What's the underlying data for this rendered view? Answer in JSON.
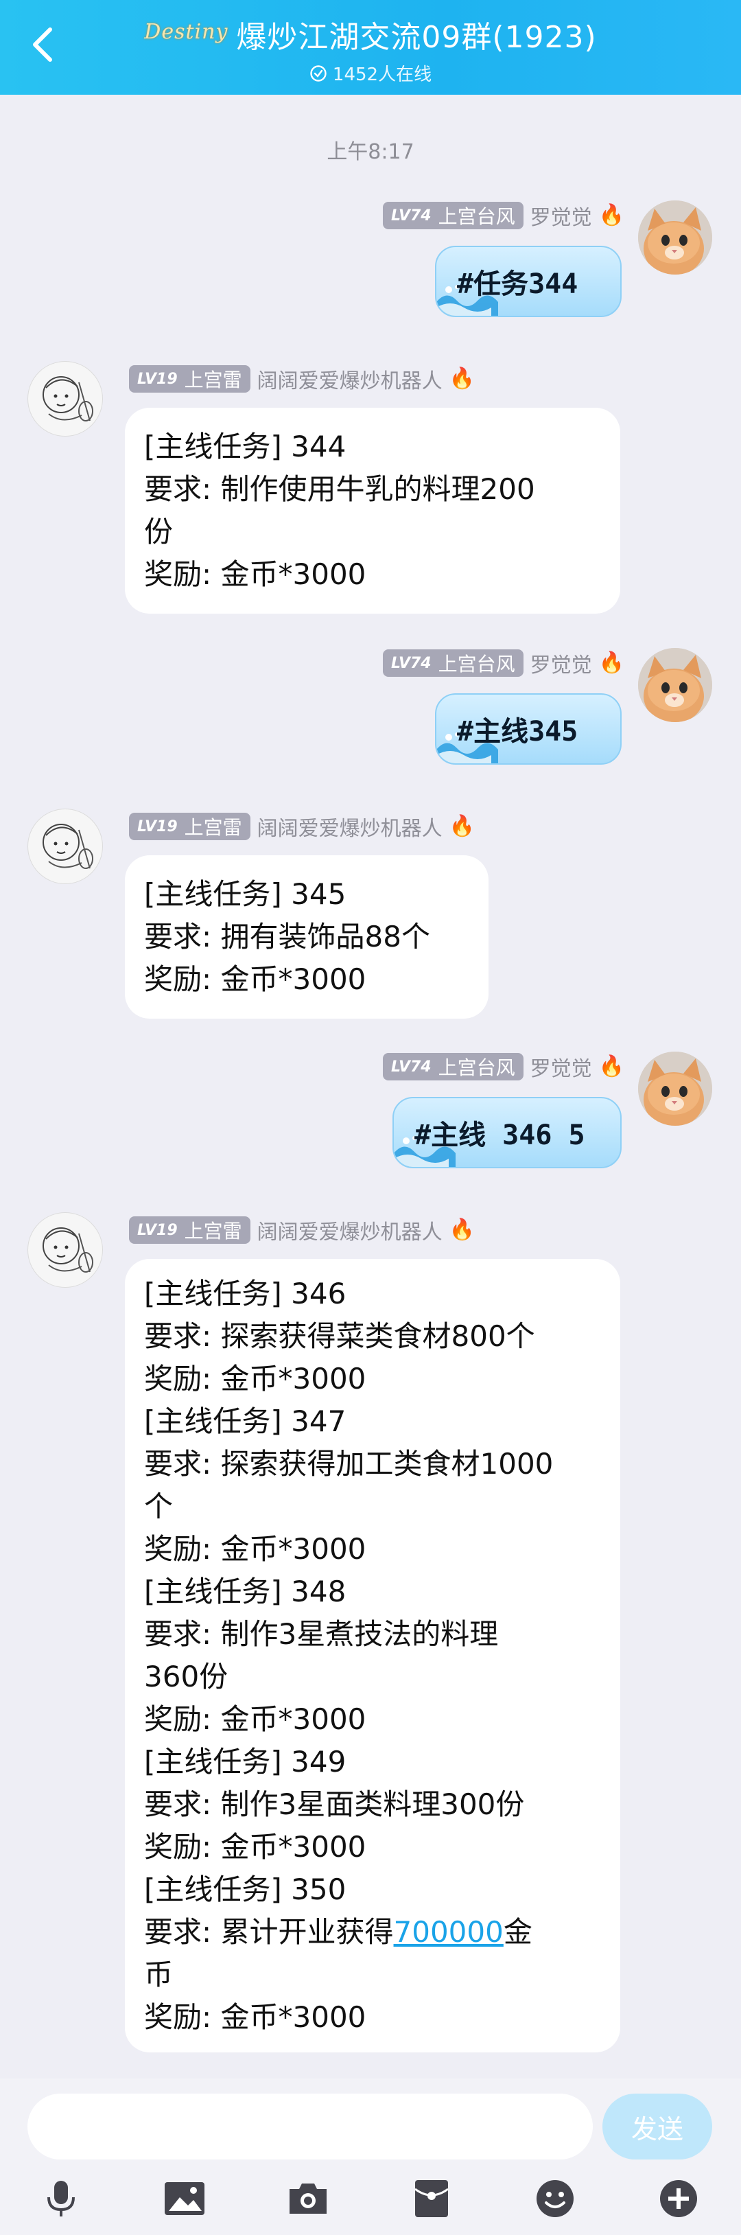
{
  "header": {
    "brand": "Destiny",
    "title": "爆炒江湖交流09群(1923)",
    "online": "1452人在线"
  },
  "chat": {
    "time": "上午8:17",
    "levels": {
      "user": {
        "lv": "LV74",
        "role": "上宫台风"
      },
      "bot": {
        "lv": "LV19",
        "role": "上宫雷"
      }
    },
    "names": {
      "user": "罗觉觉",
      "bot": "阔阔爱爱爆炒机器人"
    },
    "fire": "🔥",
    "messages": [
      {
        "kind": "user",
        "text": "#任务344"
      },
      {
        "kind": "bot",
        "lines": [
          "[主线任务] 344",
          "要求: 制作使用牛乳的料理200",
          "份",
          "奖励: 金币*3000"
        ]
      },
      {
        "kind": "user",
        "text": "#主线345"
      },
      {
        "kind": "bot",
        "lines": [
          "[主线任务] 345",
          "要求: 拥有装饰品88个",
          "奖励: 金币*3000"
        ]
      },
      {
        "kind": "user",
        "text": "#主线 346 5"
      },
      {
        "kind": "bot",
        "lines": [
          "[主线任务] 346",
          "要求: 探索获得菜类食材800个",
          "奖励: 金币*3000",
          "[主线任务] 347",
          "要求: 探索获得加工类食材1000",
          "个",
          "奖励: 金币*3000",
          "[主线任务] 348",
          "要求: 制作3星煮技法的料理",
          "360份",
          "奖励: 金币*3000",
          "[主线任务] 349",
          "要求: 制作3星面类料理300份",
          "奖励: 金币*3000",
          "[主线任务] 350"
        ],
        "link_line": {
          "before": "要求: 累计开业获得",
          "link": "700000",
          "after": "金"
        },
        "tail_lines": [
          "币",
          "奖励: 金币*3000"
        ]
      }
    ]
  },
  "input": {
    "send_label": "发送"
  },
  "toolbar": {
    "icons": [
      "microphone-icon",
      "image-icon",
      "camera-icon",
      "red-packet-icon",
      "emoji-icon",
      "plus-icon"
    ]
  },
  "colors": {
    "header": "#1eb3f0",
    "link": "#1aa3e8",
    "badge": "#a7a7b6"
  }
}
